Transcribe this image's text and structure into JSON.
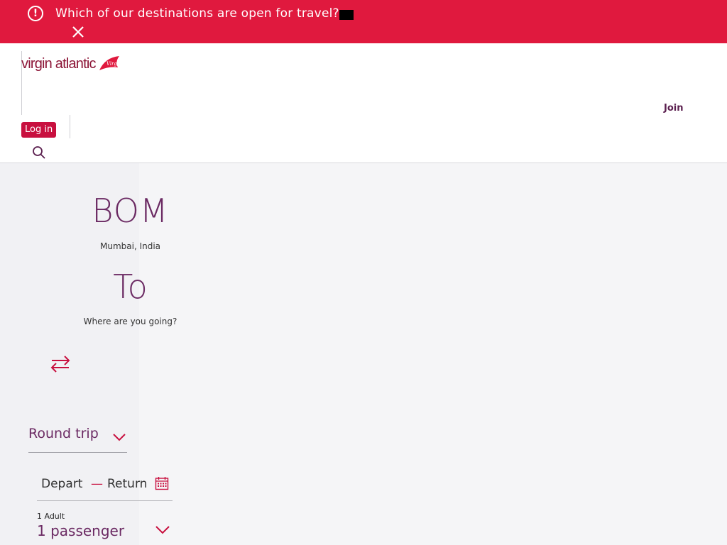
{
  "banner": {
    "message": "Which of our destinations are open for travel?",
    "alert_icon": "exclamation-circle-icon",
    "close_icon": "close-icon",
    "background": "#e0193e"
  },
  "header": {
    "logo_text": "virgin atlantic",
    "login_label": "Log in",
    "join_label": "Join",
    "search_icon": "search-icon",
    "brand_color": "#c8103f"
  },
  "booking": {
    "from": {
      "code": "BOM",
      "city": "Mumbai, India"
    },
    "to": {
      "code": "To",
      "hint": "Where are you going?"
    },
    "swap_icon": "swap-arrows-icon",
    "trip_type": "Round trip",
    "depart_label": "Depart",
    "date_separator": "—",
    "return_label": "Return",
    "calendar_icon": "calendar-icon",
    "passenger_detail": "1 Adult",
    "passenger_summary": "1 passenger"
  }
}
